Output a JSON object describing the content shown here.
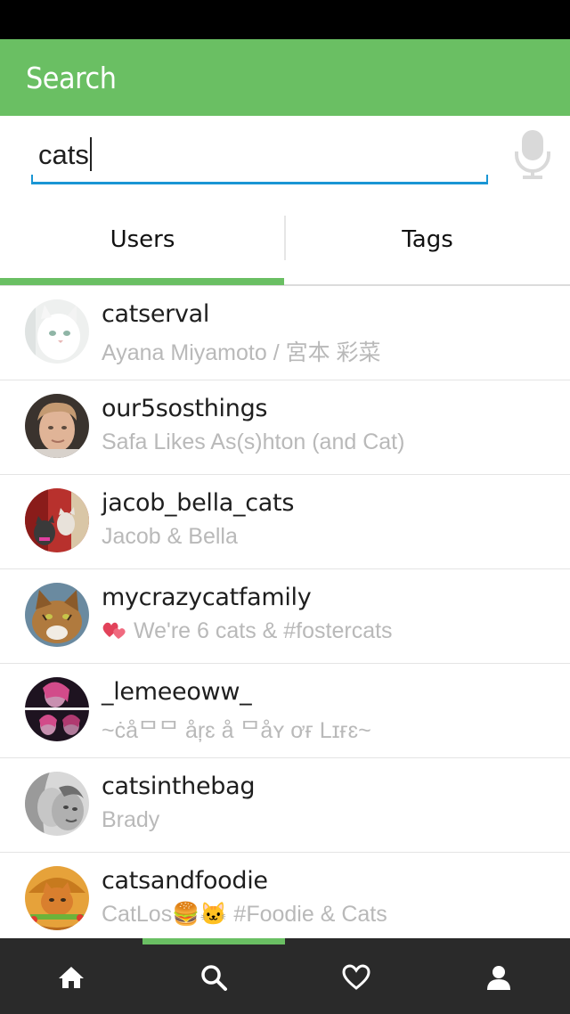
{
  "app_bar": {
    "title": "Search"
  },
  "search": {
    "value": "cats"
  },
  "tabs": [
    {
      "label": "Users",
      "selected": true
    },
    {
      "label": "Tags",
      "selected": false
    }
  ],
  "results": [
    {
      "username": "catserval",
      "fullname": "Ayana Miyamoto / 宮本 彩菜"
    },
    {
      "username": "our5sosthings",
      "fullname": "Safa Likes As(s)hton (and Cat)"
    },
    {
      "username": "jacob_bella_cats",
      "fullname": "Jacob & Bella"
    },
    {
      "username": "mycrazycatfamily",
      "fullname": "We're 6 cats & #fostercats"
    },
    {
      "username": "_lemeeoww_",
      "fullname": "~ċåᄆᄆ åŗɛ å ᄆåʏ ơғ Lɪғɛ~"
    },
    {
      "username": "catsinthebag",
      "fullname": "Brady"
    },
    {
      "username": "catsandfoodie",
      "fullname": "CatLos🍔🐱 #Foodie & Cats"
    }
  ],
  "bottom_nav": [
    {
      "icon": "home-icon",
      "selected": false
    },
    {
      "icon": "search-icon",
      "selected": true
    },
    {
      "icon": "heart-icon",
      "selected": false
    },
    {
      "icon": "profile-icon",
      "selected": false
    }
  ],
  "colors": {
    "accent": "#6abf63",
    "input_underline": "#1a96d4",
    "nav_background": "#2a2a2a"
  }
}
